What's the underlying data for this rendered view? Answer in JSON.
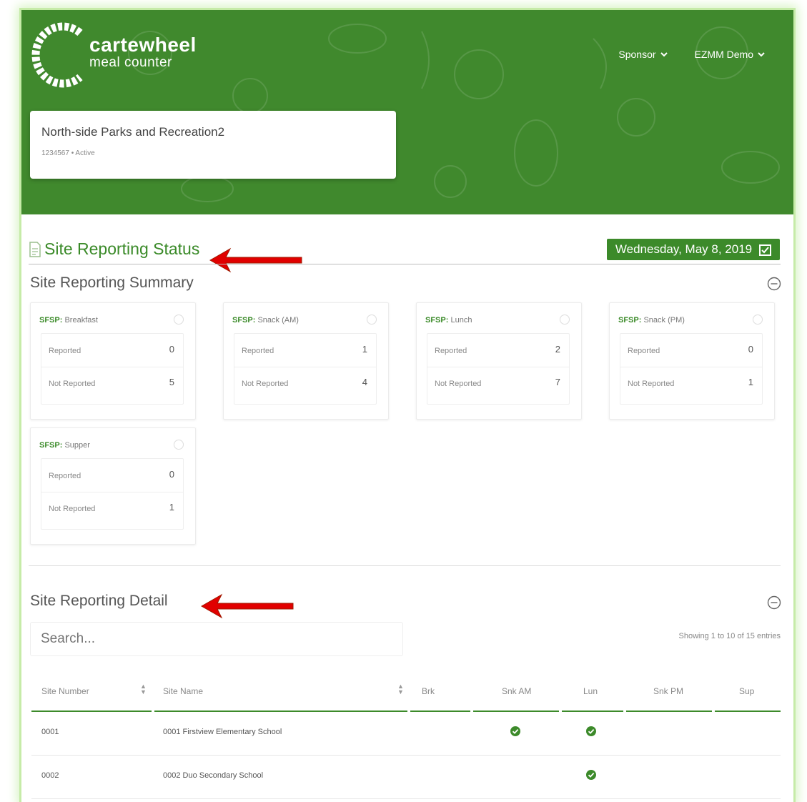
{
  "header": {
    "brand_name": "cartewheel",
    "brand_sub": "meal counter",
    "nav": [
      {
        "label": "Sponsor"
      },
      {
        "label": "EZMM Demo"
      }
    ],
    "org_name": "North-side Parks and Recreation2",
    "org_meta": "1234567 • Active",
    "brand_color": "#40892d"
  },
  "status": {
    "title": "Site Reporting Status",
    "date": "Wednesday, May 8, 2019"
  },
  "summary": {
    "title": "Site Reporting Summary",
    "meals": [
      {
        "program": "SFSP:",
        "meal": "Breakfast",
        "reported_label": "Reported",
        "reported": "0",
        "not_reported_label": "Not Reported",
        "not_reported": "5"
      },
      {
        "program": "SFSP:",
        "meal": "Snack (AM)",
        "reported_label": "Reported",
        "reported": "1",
        "not_reported_label": "Not Reported",
        "not_reported": "4"
      },
      {
        "program": "SFSP:",
        "meal": "Lunch",
        "reported_label": "Reported",
        "reported": "2",
        "not_reported_label": "Not Reported",
        "not_reported": "7"
      },
      {
        "program": "SFSP:",
        "meal": "Snack (PM)",
        "reported_label": "Reported",
        "reported": "0",
        "not_reported_label": "Not Reported",
        "not_reported": "1"
      },
      {
        "program": "SFSP:",
        "meal": "Supper",
        "reported_label": "Reported",
        "reported": "0",
        "not_reported_label": "Not Reported",
        "not_reported": "1"
      }
    ]
  },
  "detail": {
    "title": "Site Reporting Detail",
    "search_placeholder": "Search...",
    "showing": "Showing 1 to 10 of 15 entries",
    "columns": [
      "Site Number",
      "Site Name",
      "Brk",
      "Snk AM",
      "Lun",
      "Snk PM",
      "Sup"
    ],
    "rows": [
      {
        "number": "0001",
        "name": "0001 Firstview Elementary School",
        "brk": false,
        "snk_am": true,
        "lun": true,
        "snk_pm": false,
        "sup": false
      },
      {
        "number": "0002",
        "name": "0002 Duo Secondary School",
        "brk": false,
        "snk_am": false,
        "lun": true,
        "snk_pm": false,
        "sup": false
      }
    ]
  },
  "icons": {
    "nav_chevron": "chevron-down-icon",
    "doc": "document-icon",
    "calendar": "calendar-icon",
    "collapse": "minus-circle-icon",
    "check": "check-circle-icon",
    "annotation": "red-arrow-icon"
  },
  "colors": {
    "accent_green": "#3c8a2a",
    "annotation_red": "#e10000"
  }
}
